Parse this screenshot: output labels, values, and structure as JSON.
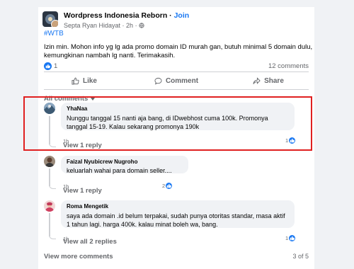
{
  "post": {
    "group_name": "Wordpress Indonesia Reborn",
    "separator": " · ",
    "join_label": "Join",
    "author": "Septa Ryan Hidayat",
    "time": "2h",
    "privacy_icon": "globe-icon",
    "hashtag": "#WTB",
    "text": "Izin min. Mohon info yg lg ada promo domain ID murah gan, butuh minimal 5 domain dulu, kemungkinan nambah lg nanti. Terimakasih.",
    "like_count": "1",
    "comment_count": "12 comments"
  },
  "actions": {
    "like": "Like",
    "comment": "Comment",
    "share": "Share"
  },
  "filter": {
    "label": "All comments"
  },
  "comments": [
    {
      "name": "YhaNaa",
      "text": "Nunggu tanggal 15 nanti aja bang, di IDwebhost cuma 100k. Promonya tanggal 15-19. Kalau sekarang promonya 190k",
      "time": "1h",
      "likes": "1",
      "replies": "View 1 reply"
    },
    {
      "name": "Faizal Nyubicrew Nugroho",
      "text": "keluarlah wahai para domain seller....",
      "time": "1h",
      "likes": "2",
      "replies": "View 1 reply"
    },
    {
      "name": "Roma Mengetik",
      "text": "saya ada domain .id belum terpakai, sudah punya otoritas standar, masa aktif 1 tahun lagi. harga 400k. kalau minat boleh wa, bang.",
      "time": "1h",
      "likes": "1",
      "replies": "View all 2 replies"
    }
  ],
  "footer": {
    "view_more": "View more comments",
    "page_count": "3 of 5"
  },
  "colors": {
    "accent": "#1877f2",
    "highlight": "#e02020",
    "muted": "#65676b"
  }
}
